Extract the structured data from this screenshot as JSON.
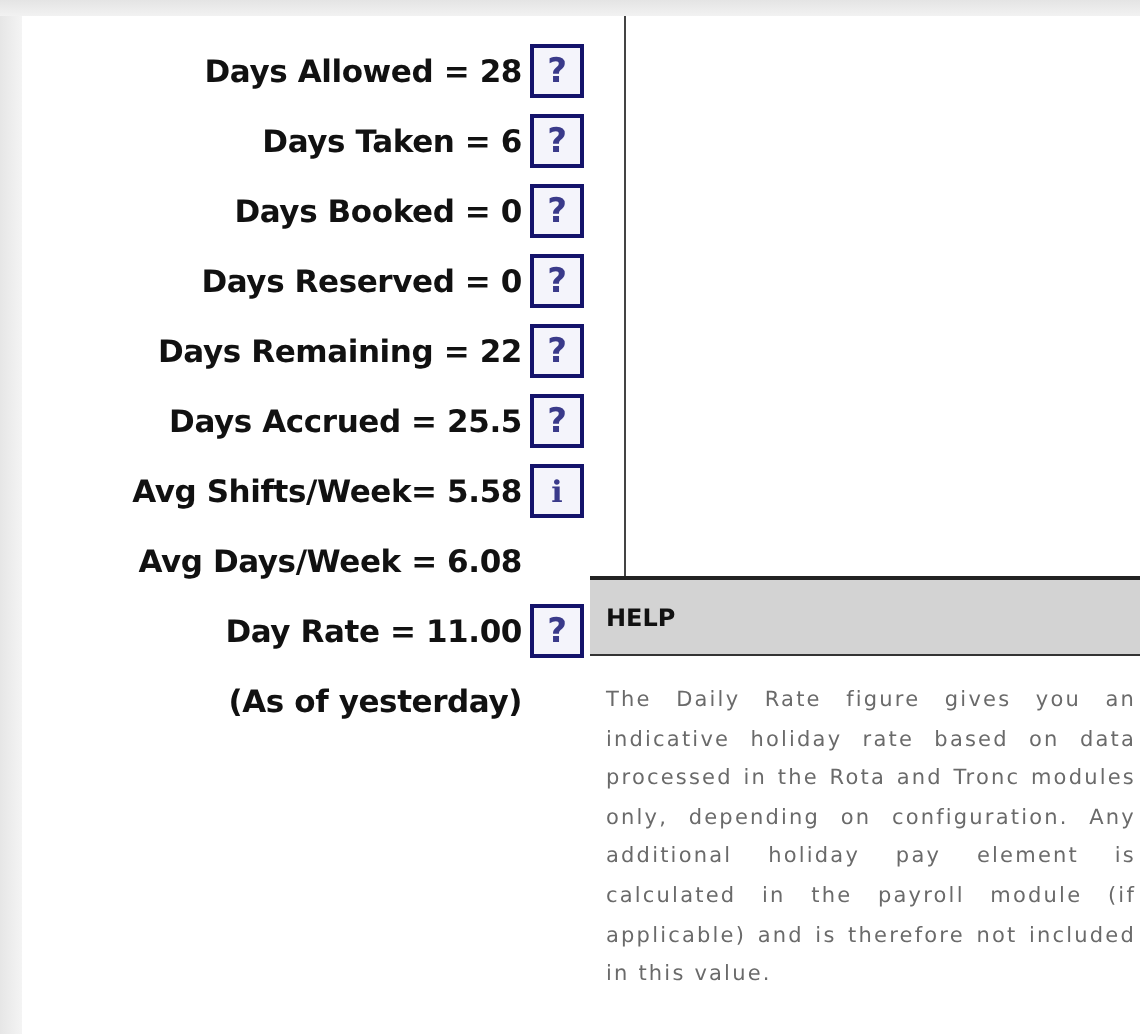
{
  "stats": [
    {
      "label": "Days Allowed = 28",
      "icon": {
        "kind": "help",
        "glyph": "?"
      }
    },
    {
      "label": "Days Taken = 6",
      "icon": {
        "kind": "help",
        "glyph": "?"
      }
    },
    {
      "label": "Days Booked = 0",
      "icon": {
        "kind": "help",
        "glyph": "?"
      }
    },
    {
      "label": "Days Reserved = 0",
      "icon": {
        "kind": "help",
        "glyph": "?"
      }
    },
    {
      "label": "Days Remaining = 22",
      "icon": {
        "kind": "help",
        "glyph": "?"
      }
    },
    {
      "label": "Days Accrued = 25.5",
      "icon": {
        "kind": "help",
        "glyph": "?"
      }
    },
    {
      "label": "Avg Shifts/Week= 5.58",
      "icon": {
        "kind": "info",
        "glyph": "i"
      }
    },
    {
      "label": "Avg Days/Week = 6.08"
    },
    {
      "label": "Day Rate = 11.00",
      "icon": {
        "kind": "help",
        "glyph": "?"
      }
    },
    {
      "label": "(As of yesterday)"
    }
  ],
  "help_popup": {
    "title": "HELP",
    "body": "The Daily Rate figure gives you an indicative holiday rate based on data processed in the Rota and Tronc modules only, depending on configuration. Any additional holiday pay element is calculated in the payroll module (if applicable) and is therefore not included in this value."
  }
}
